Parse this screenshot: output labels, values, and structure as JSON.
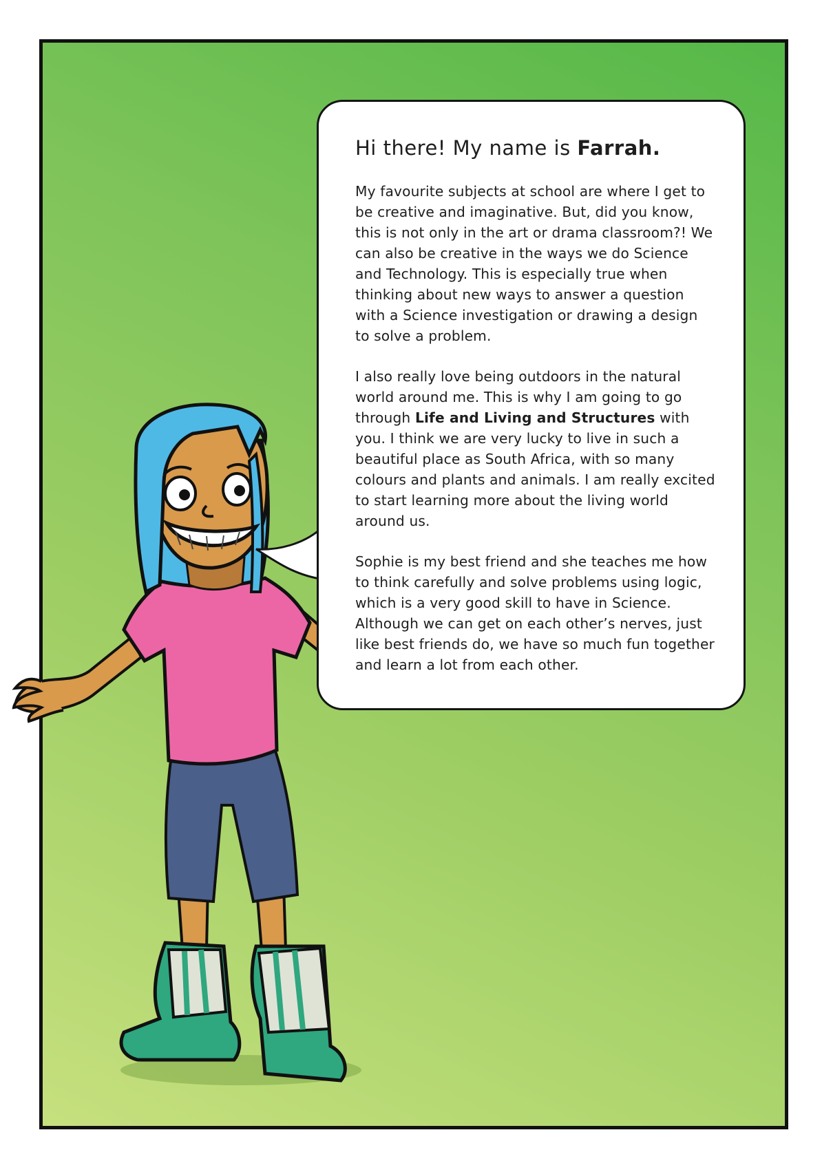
{
  "bubble": {
    "heading_prefix": "Hi there! My name is ",
    "heading_name": "Farrah.",
    "para1": "My favourite subjects at school are where I get to be creative and imaginative. But, did you know, this is not only in the art or drama classroom?! We can also be creative in the ways we do Science and Technology. This is especially true when thinking about new ways to answer a question with a Science investigation or drawing a design to solve a problem.",
    "para2_before": "I also really love being outdoors in the natural world around me. This is why I am going to go through ",
    "para2_bold": "Life and Living and Structures",
    "para2_after": " with you. I think we are very lucky to live in such a beautiful place as South Africa, with so many colours and plants and animals. I am really excited to start learning more about the living world around us.",
    "para3": "Sophie is my best friend and she teaches me how to think carefully and solve problems using logic, which is a very good skill to have in Science. Although we can get on each other’s nerves, just like best friends do, we have so much fun together and learn a lot from each other."
  },
  "colors": {
    "panel_green_top": "#55b848",
    "panel_green_bottom": "#c6e07e",
    "hair": "#4fb9e6",
    "shirt": "#ec66a5",
    "shorts": "#4a5f8a",
    "skin": "#d99a4c",
    "shoes": "#2fa77f"
  },
  "character": {
    "icon": "girl-character-illustration"
  }
}
